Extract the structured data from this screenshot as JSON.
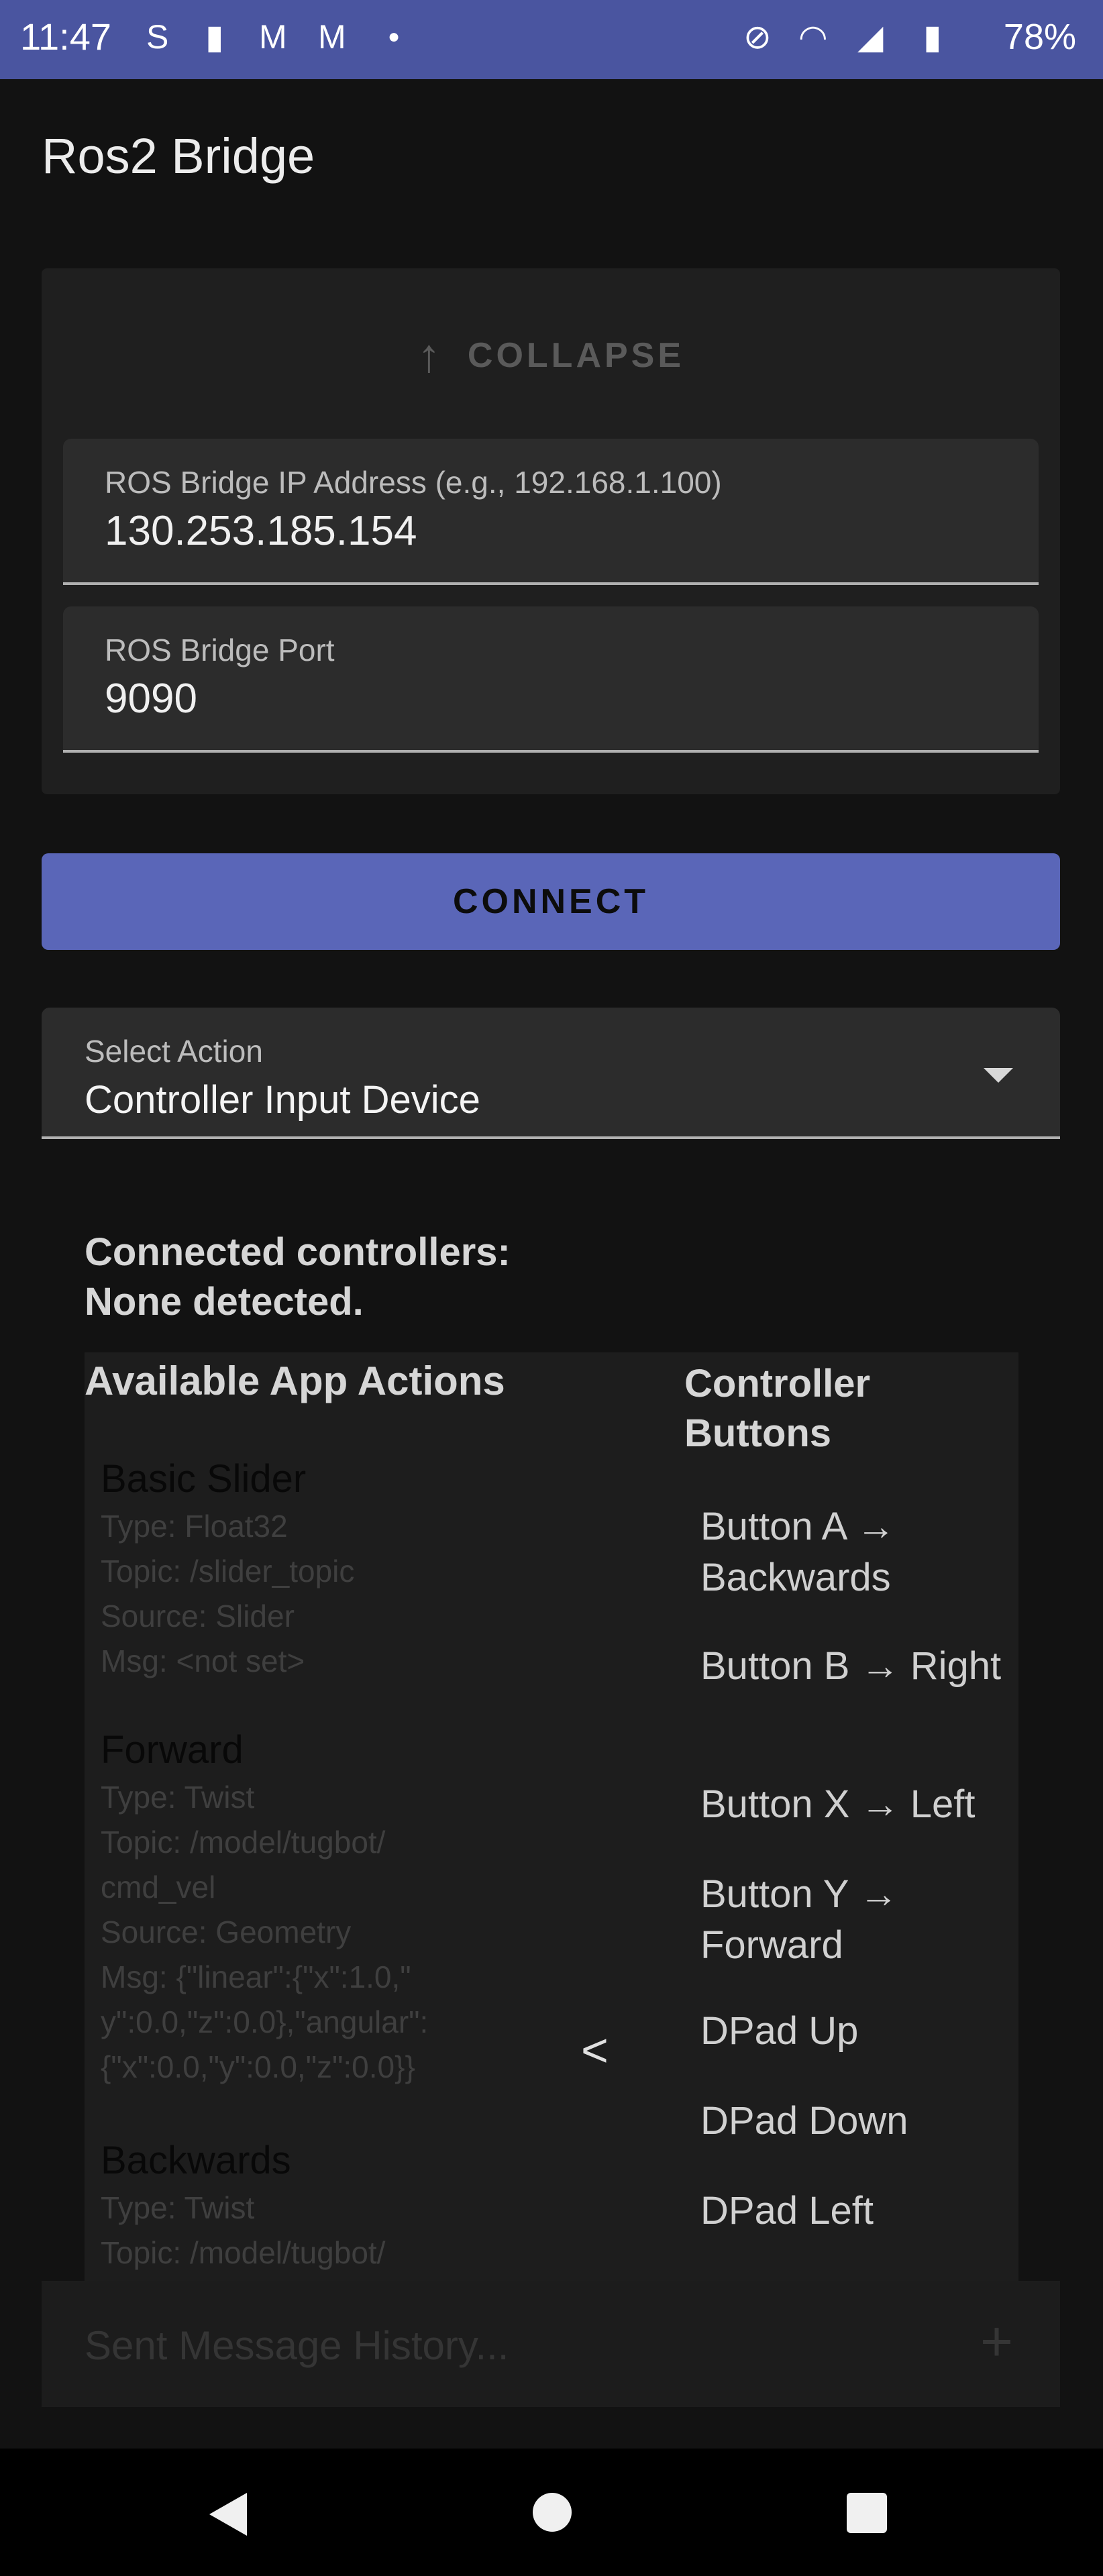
{
  "status_bar": {
    "time": "11:47",
    "notification_icons": [
      "sync-icon",
      "file-icon",
      "gmail-icon",
      "gmail-icon",
      "dot-icon"
    ],
    "system_icons": [
      "mute-icon",
      "wifi-icon",
      "signal-icon",
      "battery-icon"
    ],
    "battery": "78%"
  },
  "app": {
    "title": "Ros2 Bridge"
  },
  "settings": {
    "collapse_label": "COLLAPSE",
    "ip_field": {
      "label": "ROS Bridge IP Address (e.g., 192.168.1.100)",
      "value": "130.253.185.154"
    },
    "port_field": {
      "label": "ROS Bridge Port",
      "value": "9090"
    }
  },
  "connect_label": "CONNECT",
  "select_action": {
    "label": "Select Action",
    "value": "Controller Input Device"
  },
  "controllers": {
    "line1": "Connected controllers:",
    "line2": "None detected.",
    "actions_header": "Available App Actions",
    "buttons_header": "Controller Buttons",
    "actions": [
      {
        "name": "Basic Slider",
        "details": [
          "Type: Float32",
          "Topic: /slider_topic",
          "Source: Slider",
          "Msg: <not set>"
        ]
      },
      {
        "name": "Forward",
        "details": [
          "Type: Twist",
          "Topic: /model/tugbot/",
          "cmd_vel",
          "Source: Geometry",
          "Msg: {\"linear\":{\"x\":1.0,\"",
          "y\":0.0,\"z\":0.0},\"angular\":",
          "{\"x\":0.0,\"y\":0.0,\"z\":0.0}}"
        ]
      },
      {
        "name": "Backwards",
        "details": [
          "Type: Twist",
          "Topic: /model/tugbot/"
        ]
      }
    ],
    "assign_chevron": "<",
    "buttons": [
      "Button A → Backwards",
      "Button B → Right",
      "Button X → Left",
      "Button Y → Forward",
      "DPad Up",
      "DPad Down",
      "DPad Left"
    ]
  },
  "history": {
    "placeholder": "Sent Message History...",
    "add_icon": "+"
  },
  "nav": [
    "back-icon",
    "home-icon",
    "recents-icon"
  ]
}
